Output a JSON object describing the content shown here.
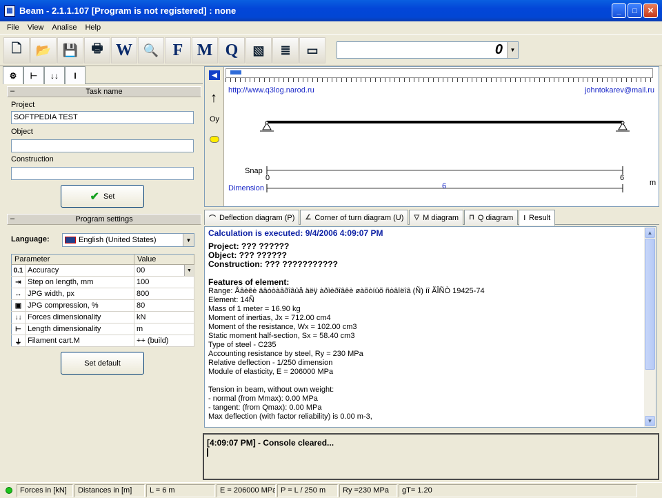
{
  "window": {
    "title": "Beam - 2.1.1.107 [Program is not registered] : none",
    "buttons": [
      "_",
      "□",
      "✕"
    ]
  },
  "menu": [
    "File",
    "View",
    "Analise",
    "Help"
  ],
  "toolbar": {
    "buttons": [
      {
        "name": "new-icon",
        "glyph": "🗋"
      },
      {
        "name": "open-folder-icon",
        "glyph": "📂"
      },
      {
        "name": "save-icon",
        "glyph": "💾"
      },
      {
        "name": "print-icon",
        "glyph": "🖶"
      },
      {
        "name": "word-export-icon",
        "glyph": "W"
      },
      {
        "name": "zoom-icon",
        "glyph": "🔍"
      },
      {
        "name": "f-zoom-icon",
        "glyph": "F"
      },
      {
        "name": "m-zoom-icon",
        "glyph": "M"
      },
      {
        "name": "q-zoom-icon",
        "glyph": "Q"
      },
      {
        "name": "hatch-icon",
        "glyph": "▧"
      },
      {
        "name": "notes-icon",
        "glyph": "≣"
      },
      {
        "name": "ruler-icon",
        "glyph": "▭"
      }
    ],
    "zoom_value": "0"
  },
  "left_tabs": [
    "⚙",
    "⊢",
    "↓↓",
    "I"
  ],
  "task": {
    "section": "Task name",
    "project_label": "Project",
    "project_value": "SOFTPEDIA TEST",
    "object_label": "Object",
    "object_value": "",
    "construction_label": "Construction",
    "construction_value": "",
    "set_button": "Set"
  },
  "settings": {
    "section": "Program settings",
    "language_label": "Language:",
    "language_value": "English (United States)",
    "col_param": "Parameter",
    "col_value": "Value",
    "rows": [
      {
        "icon": "0.1",
        "name": "Accuracy",
        "value": "00"
      },
      {
        "icon": "⇥",
        "name": "Step on length, mm",
        "value": "100"
      },
      {
        "icon": "↔",
        "name": "JPG width, px",
        "value": "800"
      },
      {
        "icon": "▣",
        "name": "JPG compression, %",
        "value": "80"
      },
      {
        "icon": "↓↓",
        "name": "Forces dimensionality",
        "value": "kN"
      },
      {
        "icon": "⊢",
        "name": "Length dimensionality",
        "value": "m"
      },
      {
        "icon": "⏚",
        "name": "Filament cart.M",
        "value": "++ (build)"
      }
    ],
    "set_default_button": "Set default"
  },
  "canvas": {
    "url_left": "http://www.q3log.narod.ru",
    "url_right": "johntokarev@mail.ru",
    "oy": "Oy",
    "snap": "Snap",
    "dimension": "Dimension",
    "start": "0",
    "end": "6",
    "length": "6",
    "unit": "m"
  },
  "result_tabs": [
    {
      "label": "Deflection diagram (P)",
      "icon": "⌒"
    },
    {
      "label": "Corner of turn diagram (U)",
      "icon": "∠"
    },
    {
      "label": "M diagram",
      "icon": "▽"
    },
    {
      "label": "Q diagram",
      "icon": "⊓"
    },
    {
      "label": "Result",
      "icon": "I"
    }
  ],
  "result": {
    "calc": "Calculation is executed: 9/4/2006 4:09:07 PM",
    "project": "Project:  ??? ??????",
    "object": "Object:  ??? ??????",
    "construction": "Construction:        ??? ???????????",
    "features": "Features of element:",
    "range": "Range: Åâèêè äâóòàâðîâûå äëÿ àðìèðîâêè øàõòíûõ ñòâîëîâ (Ñ) íî ÃÎÑÒ 19425-74",
    "element": "Element: 14Ñ",
    "mass": "Mass of 1 meter = 16.90 kg",
    "inertia": "Moment of inertias, Jx = 712.00 cm4",
    "resistance": "Moment of the resistance, Wx = 102.00 cm3",
    "static": "Static moment half-section, Sx = 58.40 cm3",
    "steel": "Type of steel - C235",
    "ry": "Accounting resistance by steel, Ry = 230 MPa",
    "reldef": "Relative deflection - 1/250 dimension",
    "elastic": "Module of elasticity, E = 206000 MPa",
    "tension": "Tension in beam, without own weight:",
    "normal": " - normal (from Mmax): 0.00 MPa",
    "tangent": " - tangent: (from Qmax): 0.00 MPa",
    "maxdef": "Max deflection (with factor reliability) is 0.00 m-3,"
  },
  "console": "[4:09:07 PM] - Console cleared...",
  "status": [
    "Forces in [kN]",
    "Distances in [m]",
    "L = 6 m",
    "E = 206000 MPa",
    "P = L / 250 m",
    "Ry =230 MPa",
    "gT= 1.20"
  ],
  "colors": {
    "title_bar": "#0346d8",
    "link": "#1a28c8",
    "calc_heading": "#0b1fa4",
    "status_led": "#1cc41c"
  }
}
